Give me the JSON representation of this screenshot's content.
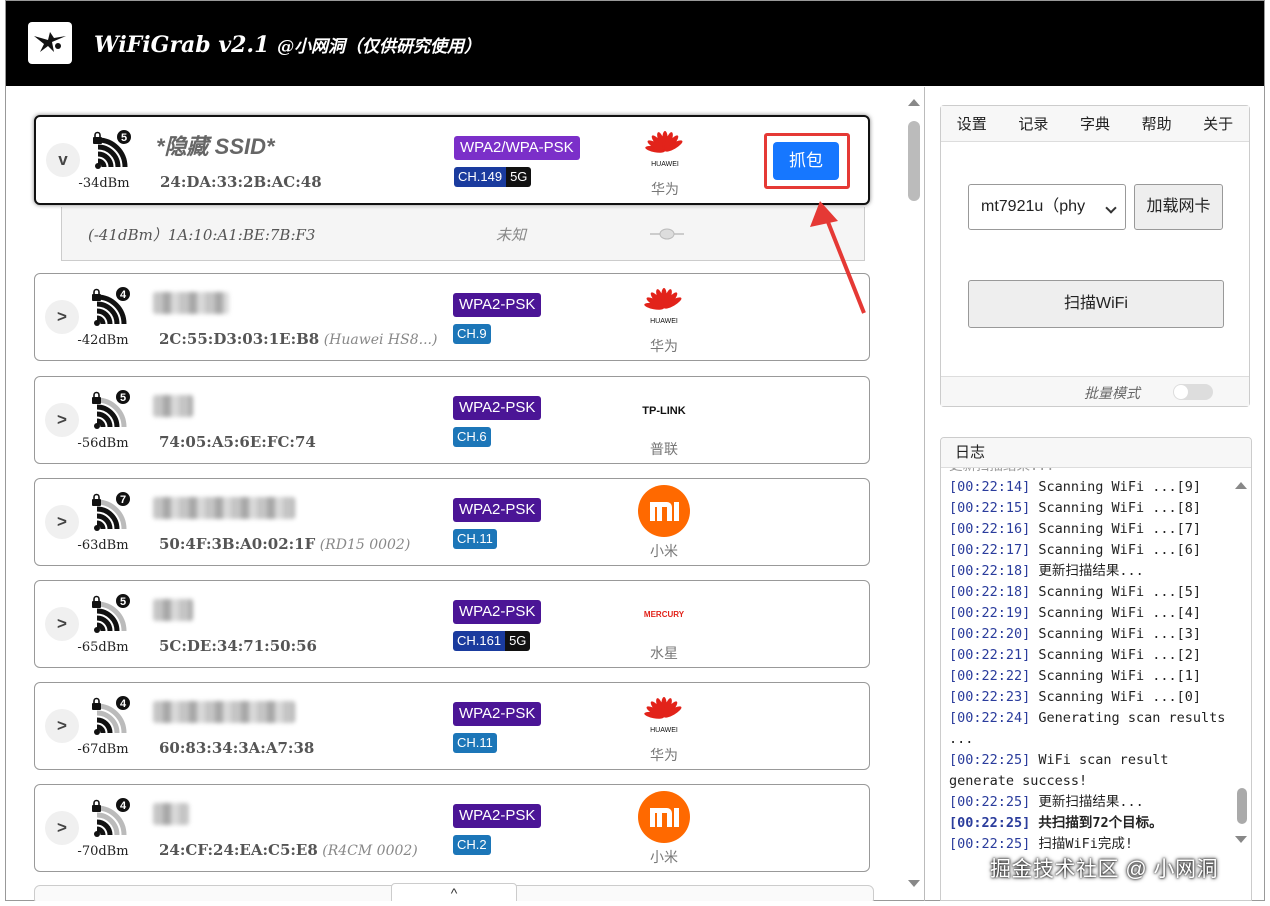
{
  "app": {
    "title": "WiFiGrab v2.1",
    "subtitle": "@小网洞（仅供研究使用）"
  },
  "networks": [
    {
      "toggle": "v",
      "ssid": "*隐藏 SSID*",
      "hidden": true,
      "rssi": "-34dBm",
      "clients": "5",
      "mac": "24:DA:33:2B:AC:48",
      "model": "",
      "encryption": "WPA2/WPA-PSK",
      "channel": "CH.149",
      "band": "5G",
      "vendor": "华为",
      "vendor_logo": "huawei-logo",
      "action": "抓包",
      "signal_level": 4
    },
    {
      "toggle": ">",
      "ssid": "",
      "hidden": false,
      "rssi": "-42dBm",
      "clients": "4",
      "mac": "2C:55:D3:03:1E:B8",
      "model": "(Huawei HS8...)",
      "encryption": "WPA2-PSK",
      "channel": "CH.9",
      "band": "",
      "vendor": "华为",
      "vendor_logo": "huawei-logo",
      "signal_level": 4
    },
    {
      "toggle": ">",
      "ssid": "",
      "hidden": false,
      "rssi": "-56dBm",
      "clients": "5",
      "mac": "74:05:A5:6E:FC:74",
      "model": "",
      "encryption": "WPA2-PSK",
      "channel": "CH.6",
      "band": "",
      "vendor": "普联",
      "vendor_logo": "tplink-logo",
      "signal_level": 3
    },
    {
      "toggle": ">",
      "ssid": "",
      "hidden": false,
      "rssi": "-63dBm",
      "clients": "7",
      "mac": "50:4F:3B:A0:02:1F",
      "model": "(RD15 0002)",
      "encryption": "WPA2-PSK",
      "channel": "CH.11",
      "band": "",
      "vendor": "小米",
      "vendor_logo": "xiaomi-logo",
      "signal_level": 3
    },
    {
      "toggle": ">",
      "ssid": "",
      "hidden": false,
      "rssi": "-65dBm",
      "clients": "5",
      "mac": "5C:DE:34:71:50:56",
      "model": "",
      "encryption": "WPA2-PSK",
      "channel": "CH.161",
      "band": "5G",
      "vendor": "水星",
      "vendor_logo": "mercury-logo",
      "signal_level": 3
    },
    {
      "toggle": ">",
      "ssid": "",
      "hidden": false,
      "rssi": "-67dBm",
      "clients": "4",
      "mac": "60:83:34:3A:A7:38",
      "model": "",
      "encryption": "WPA2-PSK",
      "channel": "CH.11",
      "band": "",
      "vendor": "华为",
      "vendor_logo": "huawei-logo",
      "signal_level": 2
    },
    {
      "toggle": ">",
      "ssid": "",
      "hidden": false,
      "rssi": "-70dBm",
      "clients": "4",
      "mac": "24:CF:24:EA:C5:E8",
      "model": "(R4CM 0002)",
      "encryption": "WPA2-PSK",
      "channel": "CH.2",
      "band": "",
      "vendor": "小米",
      "vendor_logo": "xiaomi-logo",
      "signal_level": 2
    }
  ],
  "client_row": {
    "info": "(-41dBm）1A:10:A1:BE:7B:F3",
    "vendor": "未知"
  },
  "logo_texts": {
    "huawei": "HUAWEI",
    "tplink": "TP-LINK",
    "mercury": "MERCURY",
    "xiaomi": "mi"
  },
  "bottom_tab": "^",
  "menu": [
    "设置",
    "记录",
    "字典",
    "帮助",
    "关于"
  ],
  "adapter": {
    "selected": "mt7921u（phy",
    "load_label": "加载网卡"
  },
  "scan_label": "扫描WiFi",
  "batch_label": "批量模式",
  "batch_mode_on": false,
  "log": {
    "title": "日志",
    "lines": [
      {
        "ts": "[00:22:14]",
        "msg": " Scanning WiFi ...[9]"
      },
      {
        "ts": "[00:22:15]",
        "msg": " Scanning WiFi ...[8]"
      },
      {
        "ts": "[00:22:16]",
        "msg": " Scanning WiFi ...[7]"
      },
      {
        "ts": "[00:22:17]",
        "msg": " Scanning WiFi ...[6]"
      },
      {
        "ts": "[00:22:18]",
        "msg": " 更新扫描结果..."
      },
      {
        "ts": "[00:22:18]",
        "msg": " Scanning WiFi ...[5]"
      },
      {
        "ts": "[00:22:19]",
        "msg": " Scanning WiFi ...[4]"
      },
      {
        "ts": "[00:22:20]",
        "msg": " Scanning WiFi ...[3]"
      },
      {
        "ts": "[00:22:21]",
        "msg": " Scanning WiFi ...[2]"
      },
      {
        "ts": "[00:22:22]",
        "msg": " Scanning WiFi ...[1]"
      },
      {
        "ts": "[00:22:23]",
        "msg": " Scanning WiFi ...[0]"
      },
      {
        "ts": "[00:22:24]",
        "msg": " Generating scan results ..."
      },
      {
        "ts": "[00:22:25]",
        "msg": " WiFi scan result generate success!"
      },
      {
        "ts": "[00:22:25]",
        "msg": " 更新扫描结果..."
      },
      {
        "ts": "[00:22:25]",
        "msg": " 共扫描到72个目标。",
        "bold": true
      },
      {
        "ts": "[00:22:25]",
        "msg": " 扫描WiFi完成!"
      }
    ]
  },
  "watermark": "掘金技术社区 @ 小网洞",
  "colors": {
    "accent": "#1677ff",
    "highlight": "#e53935",
    "enc_purple": "#4b1596",
    "channel_blue": "#1c76b8",
    "log_ts": "#2a3c9c"
  }
}
